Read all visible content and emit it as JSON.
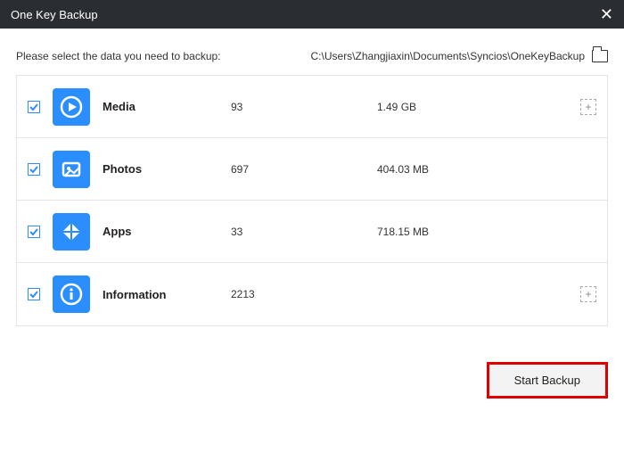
{
  "window": {
    "title": "One Key Backup"
  },
  "prompt": "Please select the data you need to backup:",
  "path": "C:\\Users\\Zhangjiaxin\\Documents\\Syncios\\OneKeyBackup",
  "items": [
    {
      "label": "Media",
      "count": "93",
      "size": "1.49 GB",
      "expandable": true,
      "checked": true
    },
    {
      "label": "Photos",
      "count": "697",
      "size": "404.03 MB",
      "expandable": false,
      "checked": true
    },
    {
      "label": "Apps",
      "count": "33",
      "size": "718.15 MB",
      "expandable": false,
      "checked": true
    },
    {
      "label": "Information",
      "count": "2213",
      "size": "",
      "expandable": true,
      "checked": true
    }
  ],
  "footer": {
    "start_label": "Start Backup"
  },
  "colors": {
    "accent": "#2b8eff",
    "titlebar": "#2a2e33",
    "highlight_border": "#e00000"
  }
}
